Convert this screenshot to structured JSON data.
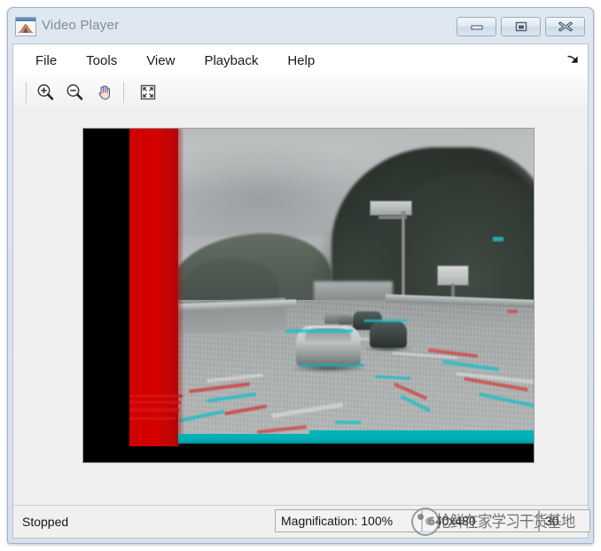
{
  "window": {
    "title": "Video Player",
    "icon": "matlab-membrane-icon",
    "controls": {
      "minimize": "minimize-icon",
      "maximize": "restore-icon",
      "close": "close-icon"
    }
  },
  "menubar": {
    "items": [
      {
        "label": "File"
      },
      {
        "label": "Tools"
      },
      {
        "label": "View"
      },
      {
        "label": "Playback"
      },
      {
        "label": "Help"
      }
    ],
    "dock_control": "undock-arrow-icon"
  },
  "toolbar": {
    "buttons": [
      {
        "name": "zoom-in-button",
        "icon": "zoom-in-icon",
        "tooltip": "Zoom In"
      },
      {
        "name": "zoom-out-button",
        "icon": "zoom-out-icon",
        "tooltip": "Zoom Out"
      },
      {
        "name": "pan-button",
        "icon": "pan-hand-icon",
        "tooltip": "Pan"
      },
      {
        "name": "maintain-fit-button",
        "icon": "fit-to-window-icon",
        "tooltip": "Maintain Fit to Window"
      }
    ]
  },
  "video": {
    "description": "Grayscale highway driving footage with red and cyan motion-estimation overlay artifacts",
    "letterbox_color": "#000000",
    "artifact_colors": {
      "red": "#cf0000",
      "cyan": "#00b2b9"
    }
  },
  "statusbar": {
    "state": "Stopped",
    "magnification_label": "Magnification: 100%",
    "dimensions": "640x480",
    "frame_rate": "30",
    "watermark": "抢鲜在家学习干货基地"
  }
}
